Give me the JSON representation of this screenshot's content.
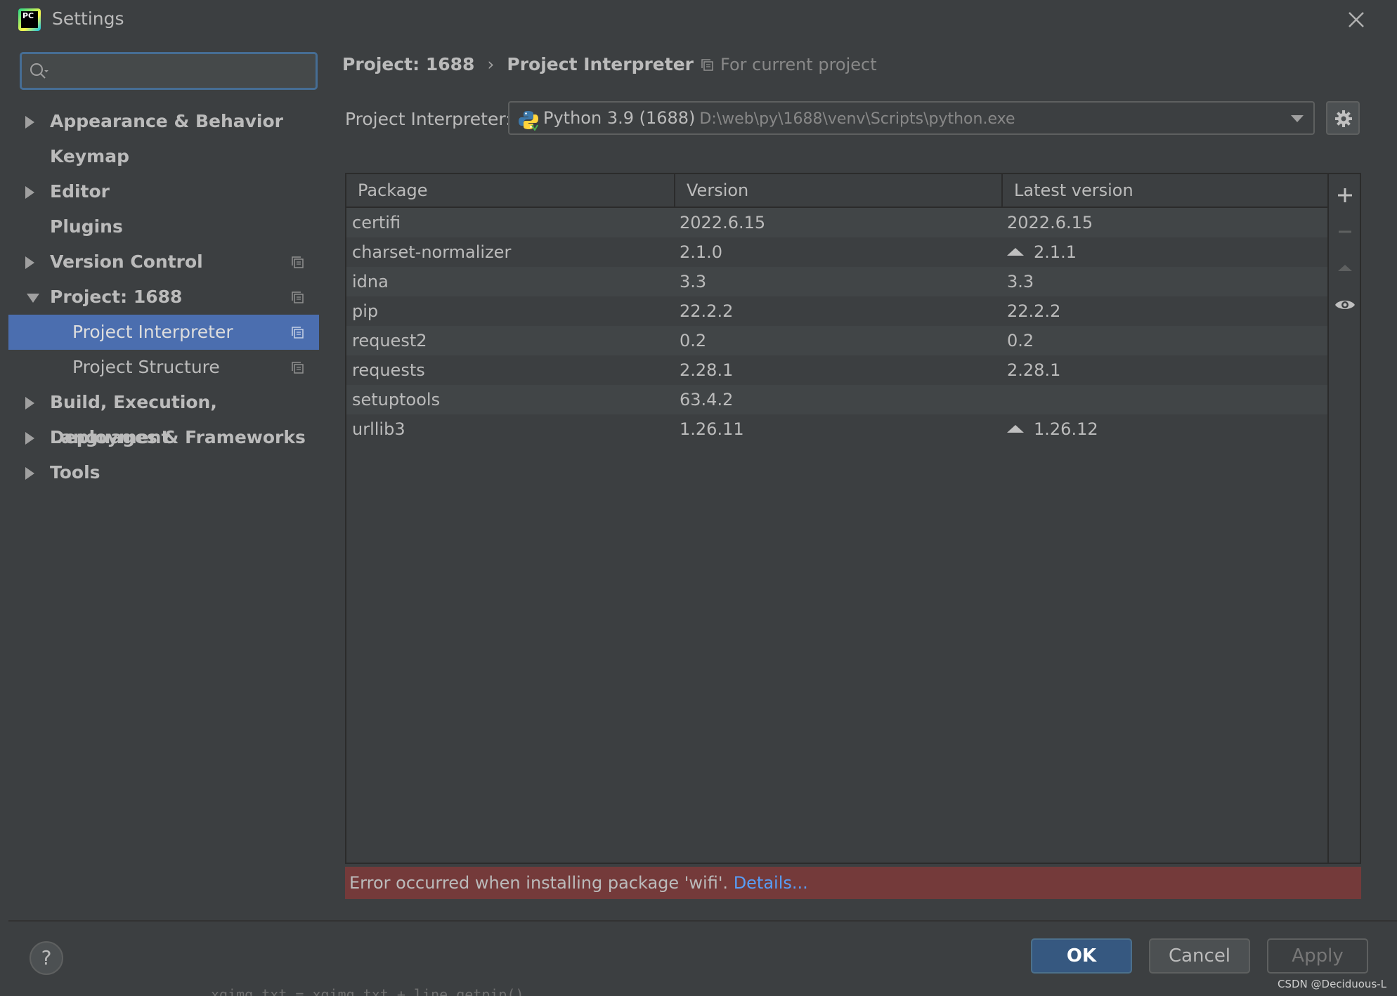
{
  "window": {
    "title": "Settings",
    "logo_text": "PC"
  },
  "sidebar": {
    "search": {
      "value": "",
      "placeholder": ""
    },
    "items": [
      {
        "label": "Appearance & Behavior",
        "expandable": true,
        "expanded": false
      },
      {
        "label": "Keymap",
        "expandable": false
      },
      {
        "label": "Editor",
        "expandable": true,
        "expanded": false
      },
      {
        "label": "Plugins",
        "expandable": false
      },
      {
        "label": "Version Control",
        "expandable": true,
        "expanded": false,
        "project_icon": true
      },
      {
        "label": "Project: 1688",
        "expandable": true,
        "expanded": true,
        "project_icon": true
      },
      {
        "label": "Project Interpreter",
        "child": true,
        "selected": true,
        "project_icon": true
      },
      {
        "label": "Project Structure",
        "child": true,
        "project_icon": true
      },
      {
        "label": "Build, Execution, Deployment",
        "expandable": true,
        "expanded": false
      },
      {
        "label": "Languages & Frameworks",
        "expandable": true,
        "expanded": false
      },
      {
        "label": "Tools",
        "expandable": true,
        "expanded": false
      }
    ]
  },
  "main": {
    "breadcrumb": {
      "parent": "Project: 1688",
      "sep": "›",
      "current": "Project Interpreter"
    },
    "scope_label": "For current project",
    "interpreter": {
      "label": "Project Interpreter:",
      "name": "Python 3.9 (1688)",
      "path": "D:\\web\\py\\1688\\venv\\Scripts\\python.exe"
    },
    "table": {
      "columns": [
        "Package",
        "Version",
        "Latest version"
      ],
      "rows": [
        {
          "package": "certifi",
          "version": "2022.6.15",
          "latest": "2022.6.15",
          "upgrade": false
        },
        {
          "package": "charset-normalizer",
          "version": "2.1.0",
          "latest": "2.1.1",
          "upgrade": true
        },
        {
          "package": "idna",
          "version": "3.3",
          "latest": "3.3",
          "upgrade": false
        },
        {
          "package": "pip",
          "version": "22.2.2",
          "latest": "22.2.2",
          "upgrade": false
        },
        {
          "package": "request2",
          "version": "0.2",
          "latest": "0.2",
          "upgrade": false
        },
        {
          "package": "requests",
          "version": "2.28.1",
          "latest": "2.28.1",
          "upgrade": false
        },
        {
          "package": "setuptools",
          "version": "63.4.2",
          "latest": "",
          "upgrade": false
        },
        {
          "package": "urllib3",
          "version": "1.26.11",
          "latest": "1.26.12",
          "upgrade": true
        }
      ]
    },
    "toolbar_icons": [
      "plus-icon",
      "minus-icon",
      "upgrade-icon",
      "eye-icon"
    ],
    "error": {
      "message": "Error occurred when installing package 'wifi'.",
      "link": "Details..."
    }
  },
  "footer": {
    "help_label": "?",
    "ok_label": "OK",
    "cancel_label": "Cancel",
    "apply_label": "Apply"
  },
  "watermark": "CSDN @Deciduous-L",
  "background_code": "xgimg_txt = xgimg_txt + line.getpip()",
  "colors": {
    "accent": "#4b6eaf",
    "error_bg": "#743a3a",
    "link": "#589df6",
    "ok_button": "#365880"
  }
}
